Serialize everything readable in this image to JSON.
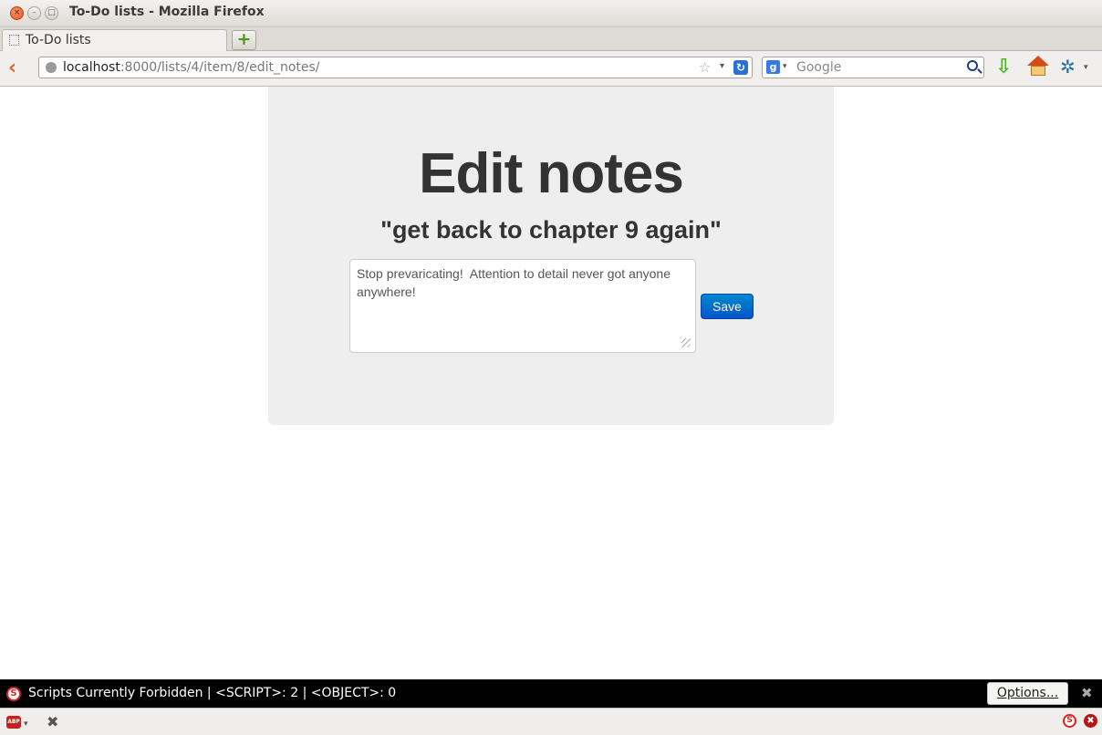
{
  "window": {
    "title": "To-Do lists - Mozilla Firefox",
    "close_glyph": "×",
    "min_glyph": "–",
    "max_glyph": "□"
  },
  "tabs": [
    {
      "label": "To-Do lists",
      "active": true
    }
  ],
  "toolbar": {
    "back_glyph": "‹",
    "url_host": "localhost",
    "url_rest": ":8000/lists/4/item/8/edit_notes/",
    "star_glyph": "☆",
    "dropdown_glyph": "▾",
    "reload_glyph": "↻",
    "search_engine_glyph": "g",
    "search_placeholder": "Google",
    "newtab_glyph": "+",
    "download_glyph": "⇩",
    "addon_glyph": "✲"
  },
  "page": {
    "heading": "Edit notes",
    "item_title": "\"get back to chapter 9 again\"",
    "notes_value": "Stop prevaricating!  Attention to detail never got anyone anywhere!",
    "save_label": "Save",
    "save_color": "#0070cc",
    "panel_color": "#eeeeee"
  },
  "noscript": {
    "icon_glyph": "S",
    "message": "Scripts Currently Forbidden | <SCRIPT>: 2 | <OBJECT>: 0",
    "options_label": "Options...",
    "close_glyph": "✖"
  },
  "statusbar": {
    "abp_label": "ABP",
    "close_glyph": "✖",
    "ns_glyph": "S",
    "x_glyph": "✖"
  }
}
